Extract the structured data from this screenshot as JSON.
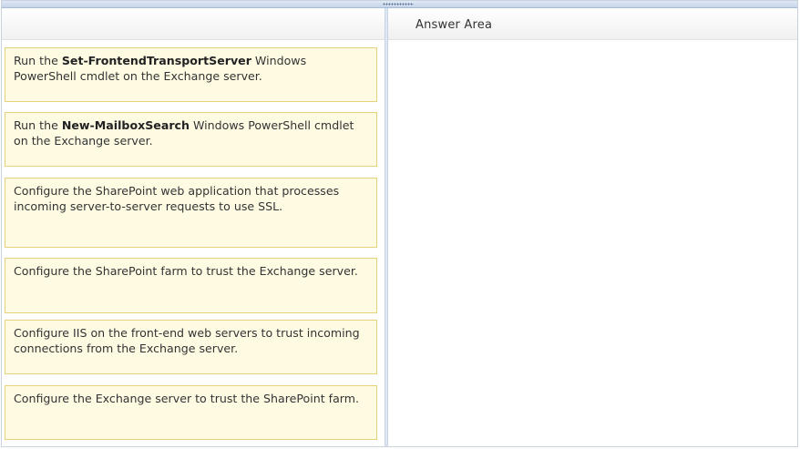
{
  "answer_area": {
    "header": "Answer Area"
  },
  "options": [
    {
      "pre": "Run the ",
      "bold": "Set-FrontendTransportServer",
      "post": " Windows PowerShell cmdlet on the Exchange server."
    },
    {
      "pre": "Run the ",
      "bold": "New-MailboxSearch",
      "post": " Windows PowerShell cmdlet on the Exchange server."
    },
    {
      "pre": "Configure the SharePoint web application that processes incoming server-to-server requests to use SSL.",
      "bold": "",
      "post": ""
    },
    {
      "pre": "Configure the SharePoint farm to trust the Exchange server.",
      "bold": "",
      "post": ""
    },
    {
      "pre": "Configure IIS on the front-end web servers to trust incoming connections from the Exchange server.",
      "bold": "",
      "post": ""
    },
    {
      "pre": "Configure the Exchange server to trust the SharePoint farm.",
      "bold": "",
      "post": ""
    }
  ]
}
